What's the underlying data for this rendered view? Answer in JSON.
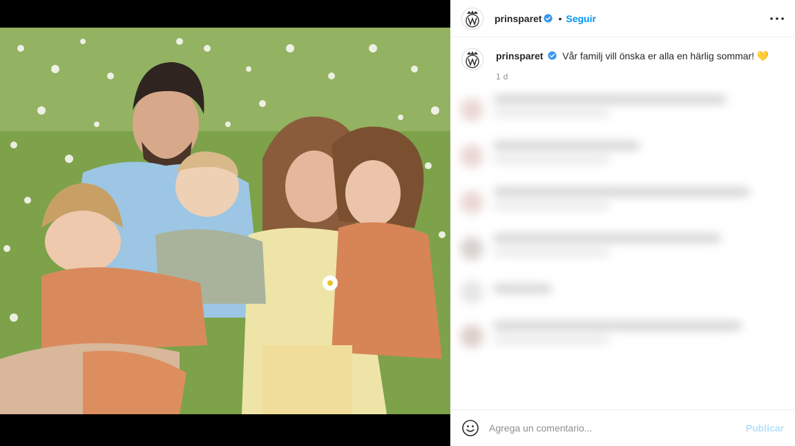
{
  "post": {
    "username": "prinsparet",
    "follow_label": "Seguir",
    "dot": "•",
    "caption_text": "Vår familj vill önska er alla en härlig sommar! 💛",
    "time_ago": "1 d"
  },
  "footer": {
    "comment_placeholder": "Agrega un comentario...",
    "publish_label": "Publicar"
  },
  "icons": {
    "verified": "verified-badge-icon",
    "more": "more-options-icon",
    "emoji": "emoji-icon"
  },
  "colors": {
    "accent": "#0095f6",
    "publish_disabled": "#b2dffc",
    "verified": "#3897f0"
  }
}
